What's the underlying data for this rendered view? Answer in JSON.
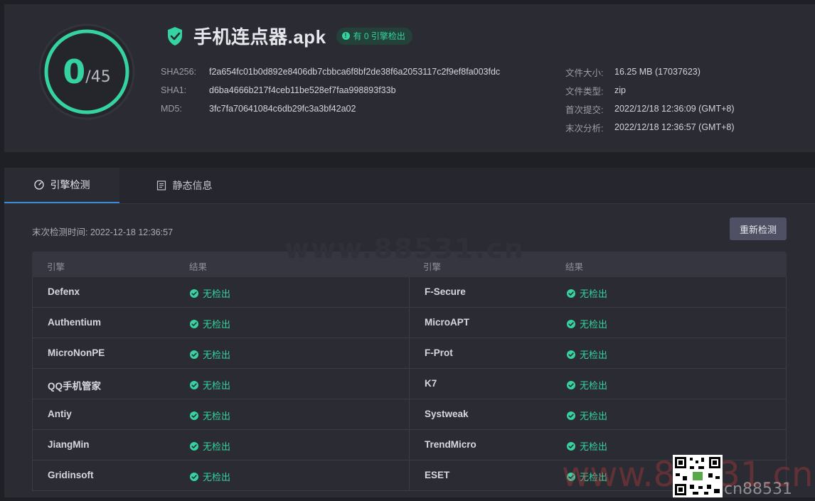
{
  "header": {
    "score": "0",
    "total": "/45",
    "file_name": "手机连点器.apk",
    "badge": "有 0 引擎检出",
    "hashes": [
      {
        "key": "SHA256:",
        "value": "f2a654fc01b0d892e8406db7cbbca6f8bf2de38f6a2053117c2f9ef8fa003fdc"
      },
      {
        "key": "SHA1:",
        "value": "d6ba4666b217f4ceb11be528ef7faa998893f33b"
      },
      {
        "key": "MD5:",
        "value": "3fc7fa70641084c6db29fc3a3bf42a02"
      }
    ],
    "info": [
      {
        "key": "文件大小:",
        "value": "16.25 MB (17037623)"
      },
      {
        "key": "文件类型:",
        "value": "zip"
      },
      {
        "key": "首次提交:",
        "value": "2022/12/18 12:36:09 (GMT+8)"
      },
      {
        "key": "末次分析:",
        "value": "2022/12/18 12:36:57 (GMT+8)"
      }
    ],
    "detections": 0,
    "engines_total": 45
  },
  "tabs": {
    "engine": "引擎检测",
    "static": "静态信息"
  },
  "scan": {
    "last_time": "末次检测时间: 2022-12-18 12:36:57",
    "rescan_label": "重新检测"
  },
  "table": {
    "col_engine": "引擎",
    "col_result": "结果",
    "rows": [
      {
        "left": "Defenx",
        "left_result": "无检出",
        "right": "F-Secure",
        "right_result": "无检出"
      },
      {
        "left": "Authentium",
        "left_result": "无检出",
        "right": "MicroAPT",
        "right_result": "无检出"
      },
      {
        "left": "MicroNonPE",
        "left_result": "无检出",
        "right": "F-Prot",
        "right_result": "无检出"
      },
      {
        "left": "QQ手机管家",
        "left_result": "无检出",
        "right": "K7",
        "right_result": "无检出"
      },
      {
        "left": "Antiy",
        "left_result": "无检出",
        "right": "Systweak",
        "right_result": "无检出"
      },
      {
        "left": "JiangMin",
        "left_result": "无检出",
        "right": "TrendMicro",
        "right_result": "无检出"
      },
      {
        "left": "Gridinsoft",
        "left_result": "无检出",
        "right": "ESET",
        "right_result": "无检出"
      }
    ]
  },
  "watermarks": {
    "center": "www.88531.cn",
    "corner": "www.88531.cn",
    "small": "cn88531"
  },
  "colors": {
    "accent_green": "#34d3a0",
    "tab_active": "#3b8ad8",
    "background": "#1f1f26",
    "card": "#2b2b33"
  }
}
